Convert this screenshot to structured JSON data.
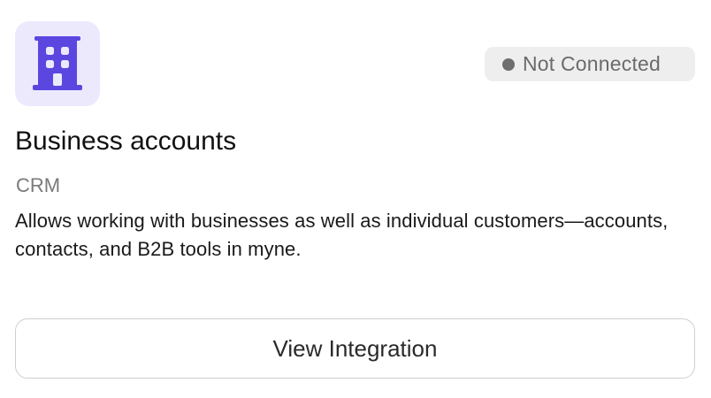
{
  "integration": {
    "icon": "building-icon",
    "accent_color": "#5b47e0",
    "icon_bg_color": "#ece9fd",
    "status": {
      "label": "Not Connected",
      "dot_color": "#6e6e6e"
    },
    "title": "Business accounts",
    "category": "CRM",
    "description": "Allows working with businesses as well as individual customers—accounts, contacts, and B2B tools in myne.",
    "action_label": "View Integration"
  }
}
